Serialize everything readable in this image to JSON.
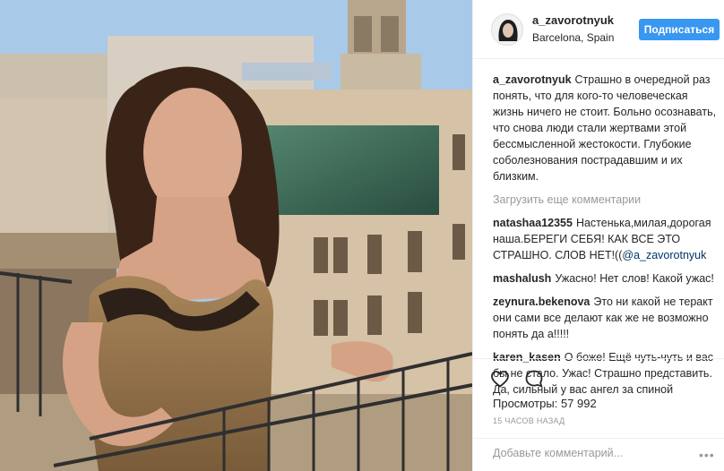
{
  "post": {
    "username": "a_zavorotnyuk",
    "location": "Barcelona, Spain",
    "follow_label": "Подписаться"
  },
  "caption": {
    "username": "a_zavorotnyuk",
    "text": "Страшно в очередной раз понять, что для кого-то человеческая жизнь ничего не стоит. Больно осознавать, что снова люди стали жертвами этой бессмысленной жестокости. Глубокие соболезнования пострадавшим и их близким."
  },
  "load_more_label": "Загрузить еще комментарии",
  "comments": [
    {
      "username": "natashaa12355",
      "text": "Настенька,милая,дорогая наша.БЕРЕГИ СЕБЯ! КАК ВСЕ ЭТО СТРАШНО. СЛОВ НЕТ!((",
      "mention": "@a_zavorotnyuk"
    },
    {
      "username": "mashalush",
      "text": "Ужасно! Нет слов! Какой ужас!",
      "mention": ""
    },
    {
      "username": "zeynura.bekenova",
      "text": "Это ни какой не теракт они сами все делают как же не возможно понять да а!!!!!",
      "mention": ""
    },
    {
      "username": "karen_kasen",
      "text": "О боже! Ещё чуть-чуть и вас бы не стало. Ужас! Страшно представить. Да, сильный у вас ангел за спиной",
      "mention": ""
    }
  ],
  "stats": {
    "views_label": "Просмотры:",
    "views_value": "57 992",
    "time": "15 ЧАСОВ НАЗАД"
  },
  "add_comment": {
    "placeholder": "Добавьте комментарий..."
  },
  "icons": {
    "like": "heart-icon",
    "comment": "comment-bubble-icon",
    "more": "more-dots-icon"
  },
  "colors": {
    "accent": "#3897f0",
    "muted": "#999999",
    "mention": "#003569"
  }
}
